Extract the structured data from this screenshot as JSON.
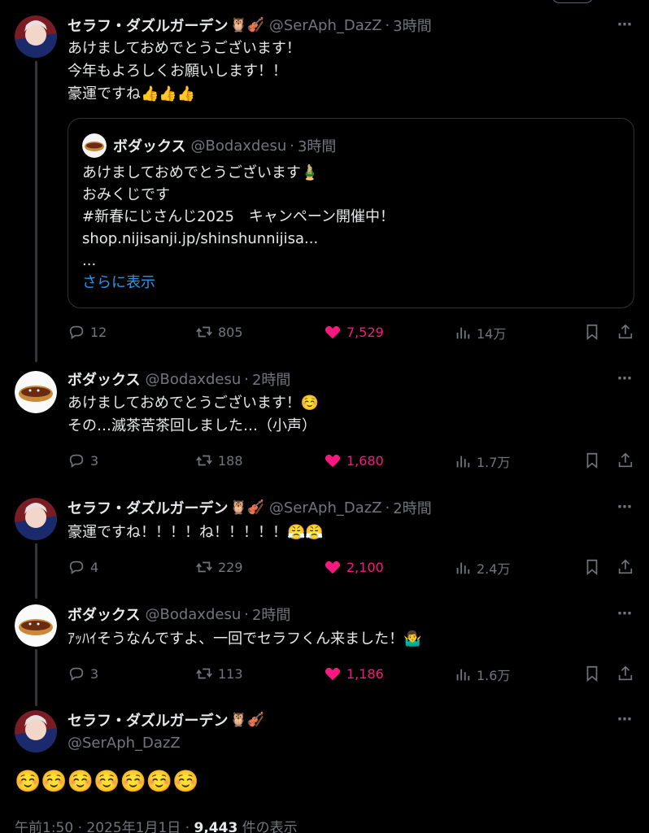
{
  "tweets": [
    {
      "name": "セラフ・ダズルガーデン",
      "badge": "🦉🎻",
      "handle": "@SerAph_DazZ",
      "time": "3時間",
      "text": "あけましておめでとうございます！\n今年もよろしくお願いします！！\n豪運ですね👍👍👍",
      "replies": "12",
      "retweets": "805",
      "likes": "7,529",
      "views": "14万"
    },
    {
      "name": "ボダックス",
      "handle": "@Bodaxdesu",
      "time": "2時間",
      "text": "あけましておめでとうございます！☺️\nその…滅茶苦茶回しました…（小声）",
      "replies": "3",
      "retweets": "188",
      "likes": "1,680",
      "views": "1.7万"
    },
    {
      "name": "セラフ・ダズルガーデン",
      "badge": "🦉🎻",
      "handle": "@SerAph_DazZ",
      "time": "2時間",
      "text": "豪運ですね！！！！ね！！！！！😤😤",
      "replies": "4",
      "retweets": "229",
      "likes": "2,100",
      "views": "2.4万"
    },
    {
      "name": "ボダックス",
      "handle": "@Bodaxdesu",
      "time": "2時間",
      "text": "ｱｯﾊｲそうなんですよ、一回でセラフくん来ました！🤷‍♂️",
      "replies": "3",
      "retweets": "113",
      "likes": "1,186",
      "views": "1.6万"
    }
  ],
  "quote": {
    "name": "ボダックス",
    "handle": "@Bodaxdesu",
    "time": "3時間",
    "text": "あけましておめでとうございます🎍\nおみくじです\n#新春にじさんじ2025　キャンペーン開催中！\nshop.nijisanji.jp/shinshunnijisa...\n...",
    "show_more": "さらに表示"
  },
  "main": {
    "name": "セラフ・ダズルガーデン",
    "badge": "🦉🎻",
    "handle": "@SerAph_DazZ",
    "text": "☺️☺️☺️☺️☺️☺️☺️",
    "meta_time": "午前1:50 · 2025年1月1日 · ",
    "views": "9,443",
    "views_label": " 件の表示"
  },
  "separator": "·",
  "more_icon": "⋯",
  "colors": {
    "accent": "#1d9bf0",
    "like": "#f91880",
    "muted": "#71767b",
    "text": "#e7e9ea",
    "bg": "#000000"
  },
  "icons": [
    "reply-icon",
    "retweet-icon",
    "heart-icon",
    "views-icon",
    "bookmark-icon",
    "share-icon",
    "more-icon"
  ]
}
